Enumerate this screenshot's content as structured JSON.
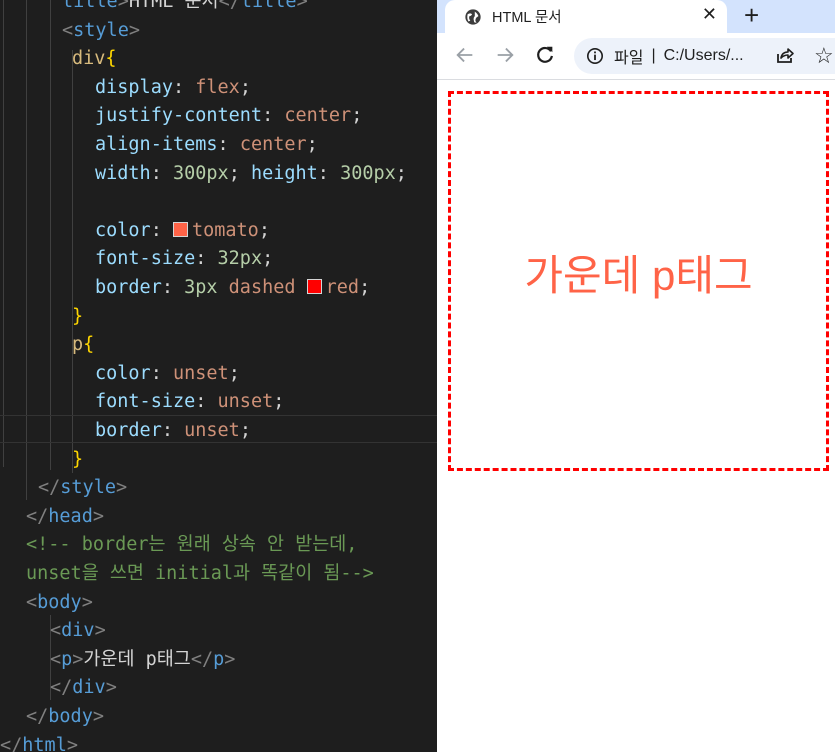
{
  "editor": {
    "lines": [
      [
        {
          "c": "tag",
          "t": "title"
        },
        {
          "c": "br",
          "t": ">"
        },
        {
          "c": "txt",
          "t": "HTML 문서"
        },
        {
          "c": "br",
          "t": "</"
        },
        {
          "c": "tag",
          "t": "title"
        },
        {
          "c": "br",
          "t": ">"
        }
      ],
      [
        {
          "c": "br",
          "t": "<"
        },
        {
          "c": "tag",
          "t": "style"
        },
        {
          "c": "br",
          "t": ">"
        }
      ],
      [
        {
          "c": "sel",
          "t": "div"
        },
        {
          "c": "brace",
          "t": "{"
        }
      ],
      [
        {
          "c": "prop",
          "t": "display"
        },
        {
          "c": "txt",
          "t": ": "
        },
        {
          "c": "val",
          "t": "flex"
        },
        {
          "c": "txt",
          "t": ";"
        }
      ],
      [
        {
          "c": "prop",
          "t": "justify-content"
        },
        {
          "c": "txt",
          "t": ": "
        },
        {
          "c": "val",
          "t": "center"
        },
        {
          "c": "txt",
          "t": ";"
        }
      ],
      [
        {
          "c": "prop",
          "t": "align-items"
        },
        {
          "c": "txt",
          "t": ": "
        },
        {
          "c": "val",
          "t": "center"
        },
        {
          "c": "txt",
          "t": ";"
        }
      ],
      [
        {
          "c": "prop",
          "t": "width"
        },
        {
          "c": "txt",
          "t": ": "
        },
        {
          "c": "num",
          "t": "300px"
        },
        {
          "c": "txt",
          "t": "; "
        },
        {
          "c": "prop",
          "t": "height"
        },
        {
          "c": "txt",
          "t": ": "
        },
        {
          "c": "num",
          "t": "300px"
        },
        {
          "c": "txt",
          "t": ";"
        }
      ],
      [],
      [
        {
          "c": "prop",
          "t": "color"
        },
        {
          "c": "txt",
          "t": ": "
        },
        {
          "c": "swatch",
          "t": "#ff6347"
        },
        {
          "c": "val",
          "t": "tomato"
        },
        {
          "c": "txt",
          "t": ";"
        }
      ],
      [
        {
          "c": "prop",
          "t": "font-size"
        },
        {
          "c": "txt",
          "t": ": "
        },
        {
          "c": "num",
          "t": "32px"
        },
        {
          "c": "txt",
          "t": ";"
        }
      ],
      [
        {
          "c": "prop",
          "t": "border"
        },
        {
          "c": "txt",
          "t": ": "
        },
        {
          "c": "num",
          "t": "3px"
        },
        {
          "c": "txt",
          "t": " "
        },
        {
          "c": "val",
          "t": "dashed"
        },
        {
          "c": "txt",
          "t": " "
        },
        {
          "c": "swatch",
          "t": "#ff0000"
        },
        {
          "c": "val",
          "t": "red"
        },
        {
          "c": "txt",
          "t": ";"
        }
      ],
      [
        {
          "c": "brace",
          "t": "}"
        }
      ],
      [
        {
          "c": "sel",
          "t": "p"
        },
        {
          "c": "brace",
          "t": "{"
        }
      ],
      [
        {
          "c": "prop",
          "t": "color"
        },
        {
          "c": "txt",
          "t": ": "
        },
        {
          "c": "val",
          "t": "unset"
        },
        {
          "c": "txt",
          "t": ";"
        }
      ],
      [
        {
          "c": "prop",
          "t": "font-size"
        },
        {
          "c": "txt",
          "t": ": "
        },
        {
          "c": "val",
          "t": "unset"
        },
        {
          "c": "txt",
          "t": ";"
        }
      ],
      [
        {
          "c": "prop",
          "t": "border"
        },
        {
          "c": "txt",
          "t": ": "
        },
        {
          "c": "val",
          "t": "unset"
        },
        {
          "c": "txt",
          "t": ";"
        }
      ],
      [
        {
          "c": "brace",
          "t": "}"
        }
      ],
      [
        {
          "c": "br",
          "t": "</"
        },
        {
          "c": "tag",
          "t": "style"
        },
        {
          "c": "br",
          "t": ">"
        }
      ],
      [
        {
          "c": "br",
          "t": "</"
        },
        {
          "c": "tag",
          "t": "head"
        },
        {
          "c": "br",
          "t": ">"
        }
      ],
      [
        {
          "c": "cmt",
          "t": "<!-- border는 원래 상속 안 받는데,"
        }
      ],
      [
        {
          "c": "cmt",
          "t": "unset을 쓰면 initial과 똑같이 됨-->"
        }
      ],
      [
        {
          "c": "br",
          "t": "<"
        },
        {
          "c": "tag",
          "t": "body"
        },
        {
          "c": "br",
          "t": ">"
        }
      ],
      [
        {
          "c": "br",
          "t": "<"
        },
        {
          "c": "tag",
          "t": "div"
        },
        {
          "c": "br",
          "t": ">"
        }
      ],
      [
        {
          "c": "br",
          "t": "<"
        },
        {
          "c": "tag",
          "t": "p"
        },
        {
          "c": "br",
          "t": ">"
        },
        {
          "c": "txt",
          "t": "가운데 p태그"
        },
        {
          "c": "br",
          "t": "</"
        },
        {
          "c": "tag",
          "t": "p"
        },
        {
          "c": "br",
          "t": ">"
        }
      ],
      [
        {
          "c": "br",
          "t": "</"
        },
        {
          "c": "tag",
          "t": "div"
        },
        {
          "c": "br",
          "t": ">"
        }
      ],
      [
        {
          "c": "br",
          "t": "</"
        },
        {
          "c": "tag",
          "t": "body"
        },
        {
          "c": "br",
          "t": ">"
        }
      ],
      [
        {
          "c": "br",
          "t": "</"
        },
        {
          "c": "tag",
          "t": "html"
        },
        {
          "c": "br",
          "t": ">"
        }
      ]
    ]
  },
  "browser": {
    "tab_title": "HTML 문서",
    "tab_close": "✕",
    "new_tab": "+",
    "scheme": "파일",
    "separator": "|",
    "url": "C:/Users/...",
    "star": "☆",
    "demo_text": "가운데 p태그"
  },
  "colors": {
    "demo_text": "#ff6347",
    "demo_border": "#ff0000",
    "tabstrip": "#d3e3fd"
  }
}
